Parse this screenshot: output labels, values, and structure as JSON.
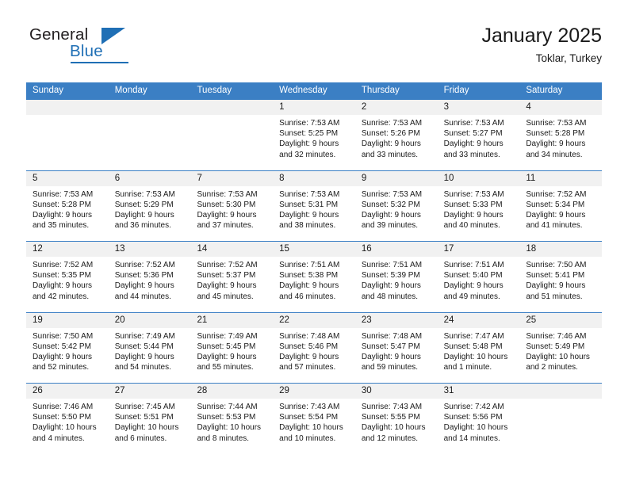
{
  "brand": {
    "name_part1": "General",
    "name_part2": "Blue"
  },
  "header": {
    "title": "January 2025",
    "subtitle": "Toklar, Turkey"
  },
  "colors": {
    "accent_blue": "#3b7fc4",
    "logo_blue": "#1f6fb5",
    "date_band": "#f1f1f1"
  },
  "weekday_headers": [
    "Sunday",
    "Monday",
    "Tuesday",
    "Wednesday",
    "Thursday",
    "Friday",
    "Saturday"
  ],
  "weeks": [
    [
      {
        "date": "",
        "sunrise": "",
        "sunset": "",
        "daylight_line1": "",
        "daylight_line2": ""
      },
      {
        "date": "",
        "sunrise": "",
        "sunset": "",
        "daylight_line1": "",
        "daylight_line2": ""
      },
      {
        "date": "",
        "sunrise": "",
        "sunset": "",
        "daylight_line1": "",
        "daylight_line2": ""
      },
      {
        "date": "1",
        "sunrise": "Sunrise: 7:53 AM",
        "sunset": "Sunset: 5:25 PM",
        "daylight_line1": "Daylight: 9 hours",
        "daylight_line2": "and 32 minutes."
      },
      {
        "date": "2",
        "sunrise": "Sunrise: 7:53 AM",
        "sunset": "Sunset: 5:26 PM",
        "daylight_line1": "Daylight: 9 hours",
        "daylight_line2": "and 33 minutes."
      },
      {
        "date": "3",
        "sunrise": "Sunrise: 7:53 AM",
        "sunset": "Sunset: 5:27 PM",
        "daylight_line1": "Daylight: 9 hours",
        "daylight_line2": "and 33 minutes."
      },
      {
        "date": "4",
        "sunrise": "Sunrise: 7:53 AM",
        "sunset": "Sunset: 5:28 PM",
        "daylight_line1": "Daylight: 9 hours",
        "daylight_line2": "and 34 minutes."
      }
    ],
    [
      {
        "date": "5",
        "sunrise": "Sunrise: 7:53 AM",
        "sunset": "Sunset: 5:28 PM",
        "daylight_line1": "Daylight: 9 hours",
        "daylight_line2": "and 35 minutes."
      },
      {
        "date": "6",
        "sunrise": "Sunrise: 7:53 AM",
        "sunset": "Sunset: 5:29 PM",
        "daylight_line1": "Daylight: 9 hours",
        "daylight_line2": "and 36 minutes."
      },
      {
        "date": "7",
        "sunrise": "Sunrise: 7:53 AM",
        "sunset": "Sunset: 5:30 PM",
        "daylight_line1": "Daylight: 9 hours",
        "daylight_line2": "and 37 minutes."
      },
      {
        "date": "8",
        "sunrise": "Sunrise: 7:53 AM",
        "sunset": "Sunset: 5:31 PM",
        "daylight_line1": "Daylight: 9 hours",
        "daylight_line2": "and 38 minutes."
      },
      {
        "date": "9",
        "sunrise": "Sunrise: 7:53 AM",
        "sunset": "Sunset: 5:32 PM",
        "daylight_line1": "Daylight: 9 hours",
        "daylight_line2": "and 39 minutes."
      },
      {
        "date": "10",
        "sunrise": "Sunrise: 7:53 AM",
        "sunset": "Sunset: 5:33 PM",
        "daylight_line1": "Daylight: 9 hours",
        "daylight_line2": "and 40 minutes."
      },
      {
        "date": "11",
        "sunrise": "Sunrise: 7:52 AM",
        "sunset": "Sunset: 5:34 PM",
        "daylight_line1": "Daylight: 9 hours",
        "daylight_line2": "and 41 minutes."
      }
    ],
    [
      {
        "date": "12",
        "sunrise": "Sunrise: 7:52 AM",
        "sunset": "Sunset: 5:35 PM",
        "daylight_line1": "Daylight: 9 hours",
        "daylight_line2": "and 42 minutes."
      },
      {
        "date": "13",
        "sunrise": "Sunrise: 7:52 AM",
        "sunset": "Sunset: 5:36 PM",
        "daylight_line1": "Daylight: 9 hours",
        "daylight_line2": "and 44 minutes."
      },
      {
        "date": "14",
        "sunrise": "Sunrise: 7:52 AM",
        "sunset": "Sunset: 5:37 PM",
        "daylight_line1": "Daylight: 9 hours",
        "daylight_line2": "and 45 minutes."
      },
      {
        "date": "15",
        "sunrise": "Sunrise: 7:51 AM",
        "sunset": "Sunset: 5:38 PM",
        "daylight_line1": "Daylight: 9 hours",
        "daylight_line2": "and 46 minutes."
      },
      {
        "date": "16",
        "sunrise": "Sunrise: 7:51 AM",
        "sunset": "Sunset: 5:39 PM",
        "daylight_line1": "Daylight: 9 hours",
        "daylight_line2": "and 48 minutes."
      },
      {
        "date": "17",
        "sunrise": "Sunrise: 7:51 AM",
        "sunset": "Sunset: 5:40 PM",
        "daylight_line1": "Daylight: 9 hours",
        "daylight_line2": "and 49 minutes."
      },
      {
        "date": "18",
        "sunrise": "Sunrise: 7:50 AM",
        "sunset": "Sunset: 5:41 PM",
        "daylight_line1": "Daylight: 9 hours",
        "daylight_line2": "and 51 minutes."
      }
    ],
    [
      {
        "date": "19",
        "sunrise": "Sunrise: 7:50 AM",
        "sunset": "Sunset: 5:42 PM",
        "daylight_line1": "Daylight: 9 hours",
        "daylight_line2": "and 52 minutes."
      },
      {
        "date": "20",
        "sunrise": "Sunrise: 7:49 AM",
        "sunset": "Sunset: 5:44 PM",
        "daylight_line1": "Daylight: 9 hours",
        "daylight_line2": "and 54 minutes."
      },
      {
        "date": "21",
        "sunrise": "Sunrise: 7:49 AM",
        "sunset": "Sunset: 5:45 PM",
        "daylight_line1": "Daylight: 9 hours",
        "daylight_line2": "and 55 minutes."
      },
      {
        "date": "22",
        "sunrise": "Sunrise: 7:48 AM",
        "sunset": "Sunset: 5:46 PM",
        "daylight_line1": "Daylight: 9 hours",
        "daylight_line2": "and 57 minutes."
      },
      {
        "date": "23",
        "sunrise": "Sunrise: 7:48 AM",
        "sunset": "Sunset: 5:47 PM",
        "daylight_line1": "Daylight: 9 hours",
        "daylight_line2": "and 59 minutes."
      },
      {
        "date": "24",
        "sunrise": "Sunrise: 7:47 AM",
        "sunset": "Sunset: 5:48 PM",
        "daylight_line1": "Daylight: 10 hours",
        "daylight_line2": "and 1 minute."
      },
      {
        "date": "25",
        "sunrise": "Sunrise: 7:46 AM",
        "sunset": "Sunset: 5:49 PM",
        "daylight_line1": "Daylight: 10 hours",
        "daylight_line2": "and 2 minutes."
      }
    ],
    [
      {
        "date": "26",
        "sunrise": "Sunrise: 7:46 AM",
        "sunset": "Sunset: 5:50 PM",
        "daylight_line1": "Daylight: 10 hours",
        "daylight_line2": "and 4 minutes."
      },
      {
        "date": "27",
        "sunrise": "Sunrise: 7:45 AM",
        "sunset": "Sunset: 5:51 PM",
        "daylight_line1": "Daylight: 10 hours",
        "daylight_line2": "and 6 minutes."
      },
      {
        "date": "28",
        "sunrise": "Sunrise: 7:44 AM",
        "sunset": "Sunset: 5:53 PM",
        "daylight_line1": "Daylight: 10 hours",
        "daylight_line2": "and 8 minutes."
      },
      {
        "date": "29",
        "sunrise": "Sunrise: 7:43 AM",
        "sunset": "Sunset: 5:54 PM",
        "daylight_line1": "Daylight: 10 hours",
        "daylight_line2": "and 10 minutes."
      },
      {
        "date": "30",
        "sunrise": "Sunrise: 7:43 AM",
        "sunset": "Sunset: 5:55 PM",
        "daylight_line1": "Daylight: 10 hours",
        "daylight_line2": "and 12 minutes."
      },
      {
        "date": "31",
        "sunrise": "Sunrise: 7:42 AM",
        "sunset": "Sunset: 5:56 PM",
        "daylight_line1": "Daylight: 10 hours",
        "daylight_line2": "and 14 minutes."
      },
      {
        "date": "",
        "sunrise": "",
        "sunset": "",
        "daylight_line1": "",
        "daylight_line2": ""
      }
    ]
  ]
}
